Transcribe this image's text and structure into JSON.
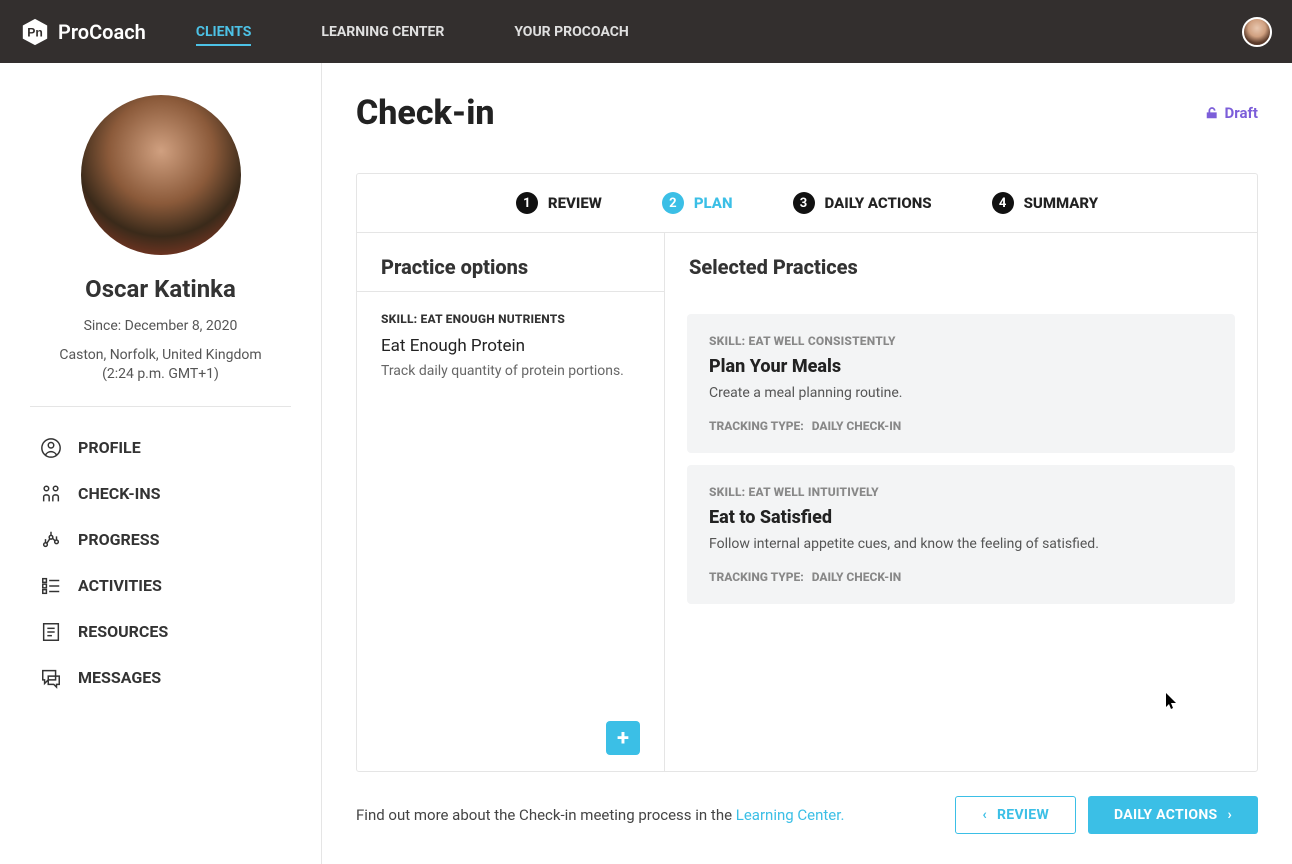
{
  "brand": {
    "name": "ProCoach"
  },
  "topnav": {
    "clients": "CLIENTS",
    "learning": "LEARNING CENTER",
    "your": "YOUR PROCOACH"
  },
  "client": {
    "name": "Oscar Katinka",
    "since_label": "Since:",
    "since_value": "December 8, 2020",
    "location": "Caston, Norfolk, United Kingdom",
    "tz": "(2:24 p.m. GMT+1)"
  },
  "sidenav": {
    "profile": "PROFILE",
    "checkins": "CHECK-INS",
    "progress": "PROGRESS",
    "activities": "ACTIVITIES",
    "resources": "RESOURCES",
    "messages": "MESSAGES"
  },
  "page": {
    "title": "Check-in",
    "draft": "Draft"
  },
  "steps": {
    "s1": "REVIEW",
    "s2": "PLAN",
    "s3": "DAILY ACTIONS",
    "s4": "SUMMARY"
  },
  "left": {
    "heading": "Practice options",
    "option1_skill": "SKILL: EAT ENOUGH NUTRIENTS",
    "option1_title": "Eat Enough Protein",
    "option1_desc": "Track daily quantity of protein portions."
  },
  "right": {
    "heading": "Selected Practices",
    "cards": [
      {
        "skill": "SKILL: EAT WELL CONSISTENTLY",
        "title": "Plan Your Meals",
        "desc": "Create a meal planning routine.",
        "track_label": "TRACKING TYPE:",
        "track_value": "DAILY CHECK-IN"
      },
      {
        "skill": "SKILL: EAT WELL INTUITIVELY",
        "title": "Eat to Satisfied",
        "desc": "Follow internal appetite cues, and know the feeling of satisfied.",
        "track_label": "TRACKING TYPE:",
        "track_value": "DAILY CHECK-IN"
      }
    ]
  },
  "footer": {
    "text_prefix": "Find out more about the Check-in meeting process in the ",
    "link": "Learning Center.",
    "prev": "REVIEW",
    "next": "DAILY ACTIONS"
  }
}
